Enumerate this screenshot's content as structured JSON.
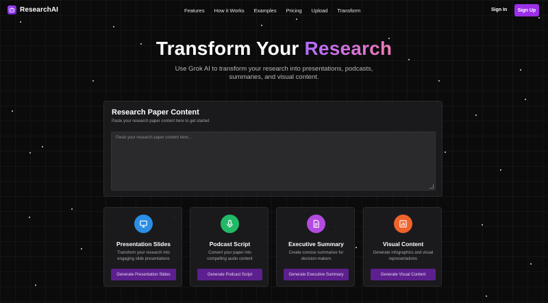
{
  "brand": {
    "name": "ResearchAI",
    "icon": "robot-icon",
    "accent": "#9b30e8"
  },
  "nav": {
    "links": [
      "Features",
      "How it Works",
      "Examples",
      "Pricing",
      "Upload",
      "Transform"
    ],
    "sign_in": "Sign In",
    "sign_up": "Sign Up"
  },
  "hero": {
    "title_plain": "Transform Your",
    "title_accent": "Research",
    "subtitle": "Use Grok AI to transform your research into presentations, podcasts, summaries, and visual content."
  },
  "input_panel": {
    "title": "Research Paper Content",
    "subtitle": "Paste your research paper content here to get started",
    "placeholder": "Paste your research paper content here..."
  },
  "cards": [
    {
      "title": "Presentation Slides",
      "description": "Transform your research into engaging slide presentations",
      "button": "Generate Presentation Slides",
      "icon": "presentation-icon",
      "color": "#2b8ee6"
    },
    {
      "title": "Podcast Script",
      "description": "Convert your paper into compelling audio content",
      "button": "Generate Podcast Script",
      "icon": "microphone-icon",
      "color": "#22b867"
    },
    {
      "title": "Executive Summary",
      "description": "Create concise summaries for decision-makers",
      "button": "Generate Executive Summary",
      "icon": "document-icon",
      "color": "#b44be0"
    },
    {
      "title": "Visual Content",
      "description": "Generate infographics and visual representations",
      "button": "Generate Visual Content",
      "icon": "bar-chart-icon",
      "color": "#f0632b"
    }
  ]
}
